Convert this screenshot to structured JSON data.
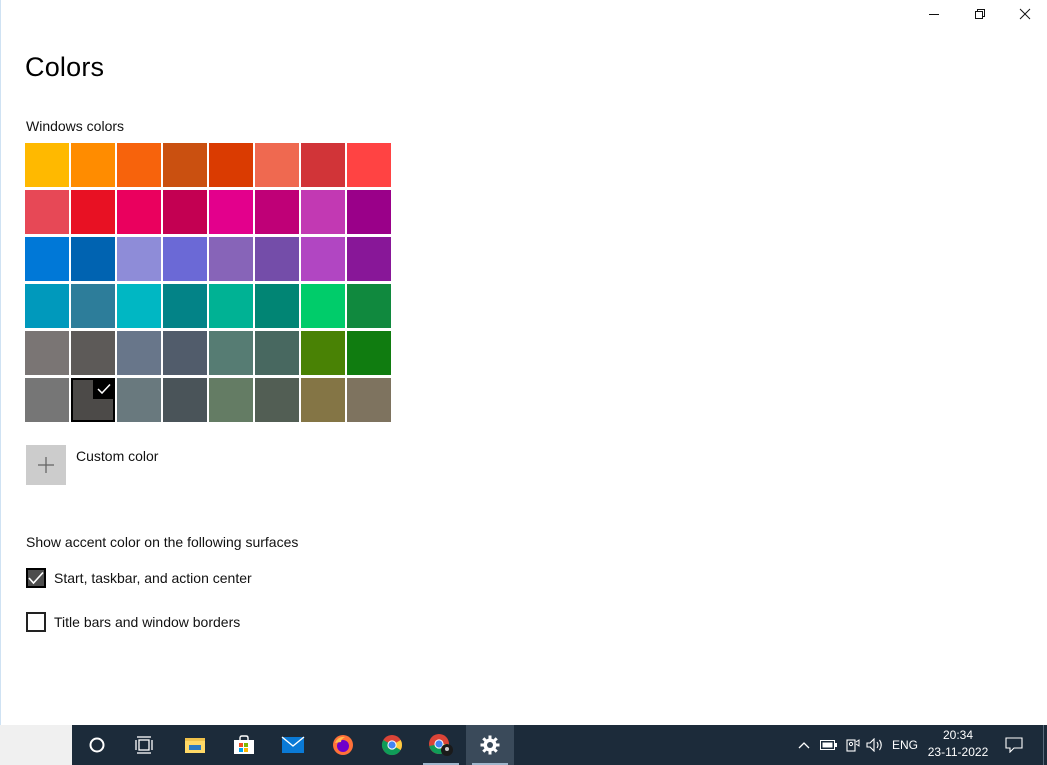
{
  "window": {
    "title_bar": {
      "minimize": "minimize-icon",
      "maximize": "restore-icon",
      "close": "close-icon"
    }
  },
  "page": {
    "title": "Colors"
  },
  "windows_colors": {
    "label": "Windows colors",
    "selected_index": 41,
    "swatches": [
      "#FFB900",
      "#FF8C00",
      "#F7630C",
      "#CA5010",
      "#DA3B01",
      "#EF6950",
      "#D13438",
      "#FF4343",
      "#E74856",
      "#E81123",
      "#EA005E",
      "#C30052",
      "#E3008C",
      "#BF0077",
      "#C239B3",
      "#9A0089",
      "#0078D7",
      "#0063B1",
      "#8E8CD8",
      "#6B69D6",
      "#8764B8",
      "#744DA9",
      "#B146C2",
      "#881798",
      "#0099BC",
      "#2D7D9A",
      "#00B7C3",
      "#038387",
      "#00B294",
      "#018574",
      "#00CC6A",
      "#10893E",
      "#7A7574",
      "#5D5A58",
      "#68768A",
      "#515C6B",
      "#567C73",
      "#486860",
      "#498205",
      "#107C10",
      "#767676",
      "#4C4A48",
      "#69797E",
      "#4A5459",
      "#647C64",
      "#525E54",
      "#847545",
      "#7E735F"
    ]
  },
  "custom_color": {
    "label": "Custom color",
    "icon": "plus-icon"
  },
  "surfaces": {
    "label": "Show accent color on the following surfaces",
    "options": [
      {
        "label": "Start, taskbar, and action center",
        "checked": true
      },
      {
        "label": "Title bars and window borders",
        "checked": false
      }
    ]
  },
  "taskbar": {
    "apps": [
      {
        "name": "cortana",
        "icon": "cortana-icon"
      },
      {
        "name": "task-view",
        "icon": "task-view-icon"
      },
      {
        "name": "file-explorer",
        "icon": "folder-icon"
      },
      {
        "name": "microsoft-store",
        "icon": "store-icon"
      },
      {
        "name": "mail",
        "icon": "mail-icon"
      },
      {
        "name": "firefox",
        "icon": "firefox-icon"
      },
      {
        "name": "chrome",
        "icon": "chrome-icon"
      },
      {
        "name": "chrome-profile",
        "icon": "chrome-profile-icon"
      },
      {
        "name": "settings",
        "icon": "settings-gear-icon"
      }
    ],
    "tray": {
      "language": "ENG",
      "time": "20:34",
      "date": "23-11-2022"
    }
  }
}
